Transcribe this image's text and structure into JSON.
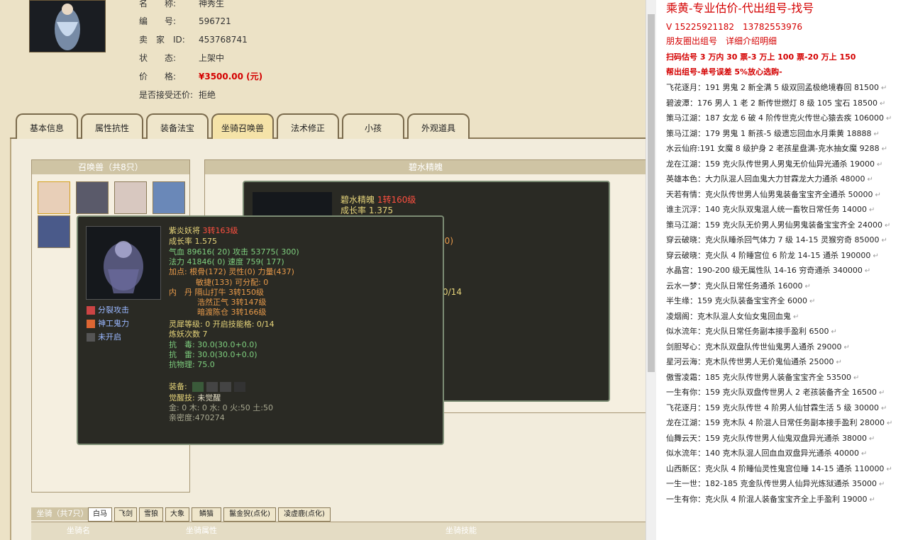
{
  "listing": {
    "rows": [
      {
        "label": "名　　称:",
        "value": "神秀生"
      },
      {
        "label": "编　　号:",
        "value": "596721"
      },
      {
        "label": "卖　家　ID:",
        "value": "453768741"
      },
      {
        "label": "状　　态:",
        "value": "上架中"
      },
      {
        "label": "价　　格:",
        "value": "¥3500.00 (元)"
      },
      {
        "label": "是否接受还价:",
        "value": "拒绝"
      }
    ]
  },
  "tabs": [
    "基本信息",
    "属性抗性",
    "装备法宝",
    "坐骑召唤兽",
    "法术修正",
    "小孩",
    "外观道具"
  ],
  "active_tab": 3,
  "pet_panel": {
    "title": "召唤兽（共8只）"
  },
  "right_panel": {
    "title": "碧水精魄"
  },
  "back_card": {
    "name": "碧水精魄",
    "level": "1转160级",
    "growth": "成长率 1.375",
    "frag1": "(0)",
    "frag2": "0/14"
  },
  "tooltip": {
    "name": "紫炎妖将",
    "level": "3转163级",
    "growth": "成长率 1.575",
    "hp": "气血 89616( 20) 攻击 53775( 300)",
    "mp": "法力 41846( 0) 速度 759( 177)",
    "points": "加点: 根骨(172) 灵性(0) 力量(437)",
    "points2": "敏捷(133) 可分配: 0",
    "neidan": "内　丹 隔山打牛 3转150级",
    "neidan2": "浩然正气 3转147级",
    "neidan3": "暗渡陈仓 3转166级",
    "skills": [
      "分裂攻击",
      "神工鬼力",
      "未开启"
    ],
    "lingxi": "灵犀等级: 0 开启技能格: 0/14",
    "lianyao": "炼妖次数 7",
    "kang1": "抗　毒: 30.0(30.0+0.0)",
    "kang2": "抗　雷: 30.0(30.0+0.0)",
    "kang3": "抗物理: 75.0",
    "equip": "装备:",
    "awaken_label": "觉醒技:",
    "awaken_value": "未觉醒",
    "elements": "金: 0 木: 0 水: 0 火:50 土:50",
    "intimacy": "亲密度:470274"
  },
  "mounts": {
    "label": "坐骑（共7只）",
    "tabs": [
      "白马",
      "飞剑",
      "雪狼",
      "大象",
      "鳞猫",
      "鬣金猊(点化)",
      "凌虚鹿(点化)"
    ],
    "cols": [
      "坐骑名",
      "坐骑属性",
      "坐骑技能"
    ]
  },
  "ad": {
    "title": "乘黄-专业估价-代出组号-找号",
    "phone": "V 15225921182　13782553976",
    "line2": "朋友圈出组号　详细介绍明细",
    "line3": "扫码估号 3 万内 30 票-3 万上 100 票-20 万上 150",
    "line4": "帮出组号-单号误差 5%放心选购-"
  },
  "accounts": [
    "飞花逐月：191 男鬼 2 新全满 5 级双回孟极绝境春回 81500",
    "碧波潭：176 男人 1 老 2 新传世燃灯 8 级 105 宝石 18500",
    "策马江湖：187 女龙 6 破 4 阶传世克火传世心猿去疾 106000",
    "策马江湖：179 男鬼 1 新孩-5 级遗忘回血水月乘黄 18888",
    "水云仙府:191 女魔 8 级护身 2 老孩星盘满-克水抽女魔 9288",
    "龙在江湖：159 克火队传世男人男鬼无价仙异光通杀 19000",
    "英雄本色：大力队混人回血鬼大力甘霖龙大力通杀 48000",
    "天若有情：克火队传世男人仙男鬼装备宝宝齐全通杀 50000",
    "谁主沉浮：140 克火队双鬼混人统一畜牧日常任务 14000",
    "策马江湖：159 克火队无价男人男仙男鬼装备宝宝齐全 24000",
    "穿云破晓：克火队睡杀回气体力 7 级 14-15 灵猴穷奇 85000",
    "穿云破晓：克火队 4 阶睡宫位 6 阶龙 14-15 通杀 190000",
    "水晶宫：190-200 级无属性队 14-16 穷奇通杀 340000",
    "云水一梦：克火队日常任务通杀 16000",
    "半生缘：159 克火队装备宝宝齐全 6000",
    "凌烟阁：克木队混人女仙女鬼回血鬼",
    "似水流年：克火队日常任务副本接手盈利 6500",
    "剑胆琴心：克木队双盘队传世仙鬼男人通杀 29000",
    "星河云海：克木队传世男人无价鬼仙通杀 25000",
    "傲雪凌霜：185 克火队传世男人装备宝宝齐全 53500",
    "一生有你：159 克火队双盘传世男人 2 老孩装备齐全 16500",
    "飞花逐月：159 克火队传世 4 阶男人仙甘霖生活 5 级 30000",
    "龙在江湖：159 克木队 4 阶混人日常任务副本接手盈利 28000",
    "仙舞云天：159 克火队传世男人仙鬼双盘异光通杀 38000",
    "似水流年：140 克木队混人回血血双盘异光通杀 40000",
    "山西新区：克火队 4 阶睡仙灵性鬼宫位睡 14-15 通杀 110000",
    "一生一世：182-185 克金队传世男人仙异光炼狱通杀 35000",
    "一生有你：克火队 4 阶混人装备宝宝齐全上手盈利 19000"
  ]
}
